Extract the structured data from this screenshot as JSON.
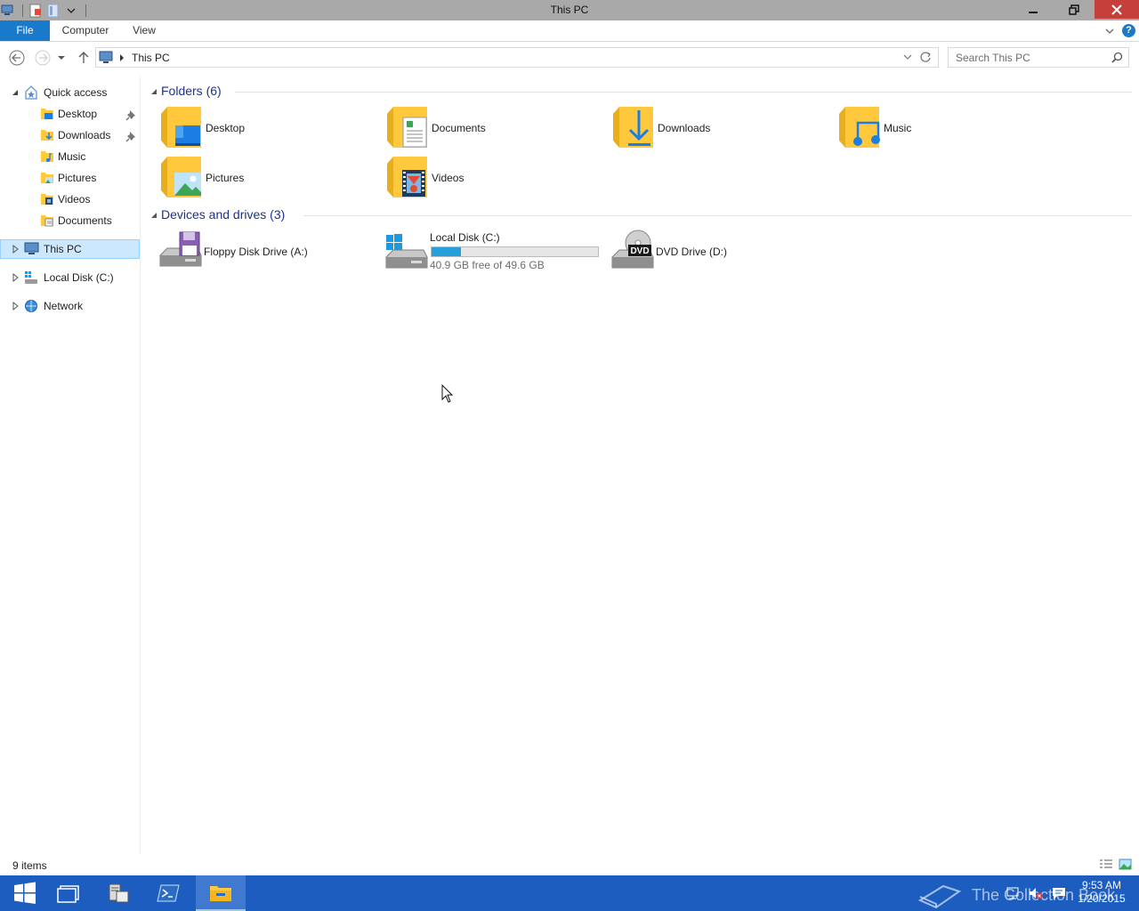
{
  "window": {
    "title": "This PC"
  },
  "ribbon": {
    "tabs": [
      {
        "label": "File"
      },
      {
        "label": "Computer"
      },
      {
        "label": "View"
      }
    ],
    "help_glyph": "?"
  },
  "address": {
    "crumb": "This PC"
  },
  "search": {
    "placeholder": "Search This PC"
  },
  "nav": {
    "quick_access": "Quick access",
    "items": [
      {
        "label": "Desktop",
        "pinned": true
      },
      {
        "label": "Downloads",
        "pinned": true
      },
      {
        "label": "Music",
        "pinned": false
      },
      {
        "label": "Pictures",
        "pinned": false
      },
      {
        "label": "Videos",
        "pinned": false
      },
      {
        "label": "Documents",
        "pinned": false
      }
    ],
    "this_pc": "This PC",
    "local_disk": "Local Disk (C:)",
    "network": "Network"
  },
  "folders": {
    "header": "Folders (6)",
    "items": [
      {
        "label": "Desktop",
        "icon": "desktop-folder-icon"
      },
      {
        "label": "Documents",
        "icon": "documents-folder-icon"
      },
      {
        "label": "Downloads",
        "icon": "downloads-folder-icon"
      },
      {
        "label": "Music",
        "icon": "music-folder-icon"
      },
      {
        "label": "Pictures",
        "icon": "pictures-folder-icon"
      },
      {
        "label": "Videos",
        "icon": "videos-folder-icon"
      }
    ]
  },
  "drives": {
    "header": "Devices and drives (3)",
    "items": [
      {
        "label": "Floppy Disk Drive (A:)"
      },
      {
        "label": "Local Disk (C:)",
        "free_text": "40.9 GB free of 49.6 GB",
        "used_fraction": 0.175
      },
      {
        "label": "DVD Drive (D:)",
        "badge": "DVD"
      }
    ]
  },
  "status": {
    "count": "9 items"
  },
  "taskbar": {
    "time": "9:53 AM",
    "date": "1/20/2015",
    "watermark": "The Collection Book"
  },
  "colors": {
    "accent": "#1979ca",
    "folder": "#ffc83d",
    "group_header": "#1e3287",
    "taskbar": "#1d5dbf",
    "close": "#c5403a",
    "capacity": "#26a0da"
  }
}
